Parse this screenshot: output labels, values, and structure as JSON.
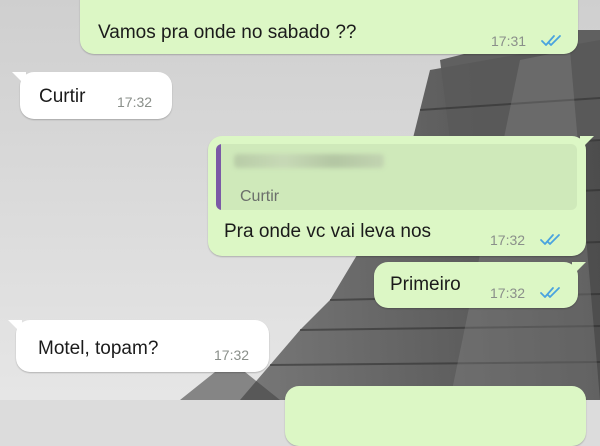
{
  "messages": [
    {
      "direction": "outgoing",
      "text": "Vamos pra onde no sabado ??",
      "time": "17:31",
      "status_icon": "double-check-icon"
    },
    {
      "direction": "incoming",
      "text": "Curtir",
      "time": "17:32"
    },
    {
      "direction": "outgoing",
      "quoted_text": "Curtir",
      "text": "Pra  onde vc vai leva nos",
      "time": "17:32",
      "status_icon": "double-check-icon"
    },
    {
      "direction": "outgoing",
      "text": "Primeiro",
      "time": "17:32",
      "status_icon": "double-check-icon"
    },
    {
      "direction": "incoming",
      "text": "Motel,  topam?",
      "time": "17:32"
    },
    {
      "direction": "outgoing",
      "text": "",
      "time": ""
    }
  ],
  "colors": {
    "outgoing_bubble": "#dcf7c5",
    "incoming_bubble": "#ffffff",
    "read_ticks": "#4aa3df",
    "quote_bar": "#7b5aa6"
  },
  "wallpaper": "black-and-white pyramid photo"
}
